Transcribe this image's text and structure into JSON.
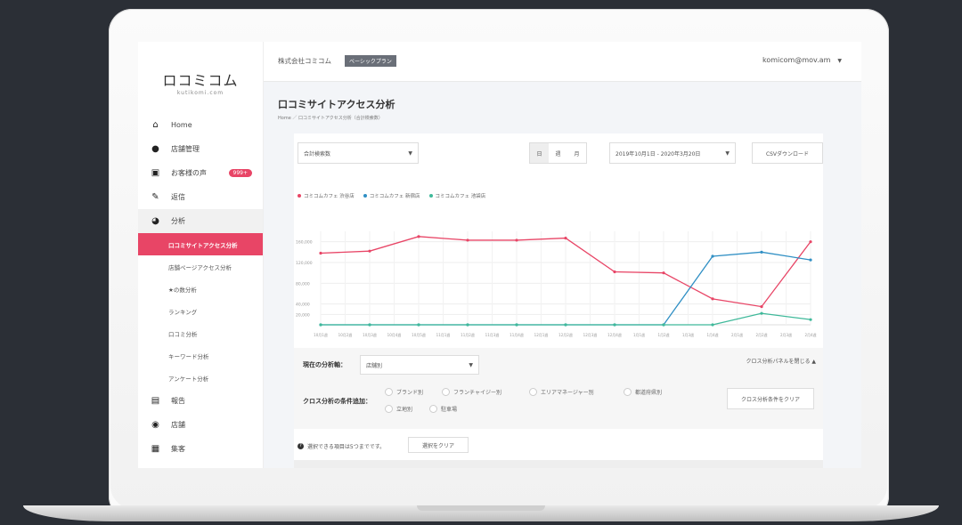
{
  "brand": {
    "logo": "ロコミコム",
    "logo_sub": "kutikomi.com"
  },
  "sidebar": {
    "items": [
      {
        "label": "Home",
        "icon": "home-icon"
      },
      {
        "label": "店舗管理",
        "icon": "store-icon"
      },
      {
        "label": "お客様の声",
        "icon": "voice-icon",
        "badge": "999+"
      },
      {
        "label": "返信",
        "icon": "edit-icon"
      },
      {
        "label": "分析",
        "icon": "pie-icon"
      }
    ],
    "sub_items": [
      {
        "label": "口コミサイトアクセス分析",
        "active": true
      },
      {
        "label": "店舗ページアクセス分析"
      },
      {
        "label": "★の数分析"
      },
      {
        "label": "ランキング"
      },
      {
        "label": "口コミ分析"
      },
      {
        "label": "キーワード分析"
      },
      {
        "label": "アンケート分析"
      }
    ],
    "items_after": [
      {
        "label": "報告",
        "icon": "report-icon"
      },
      {
        "label": "店舗",
        "icon": "location-icon"
      },
      {
        "label": "集客",
        "icon": "grid-icon"
      }
    ]
  },
  "header": {
    "company": "株式会社コミコム",
    "plan": "ベーシックプラン",
    "user": "komicom@mov.am"
  },
  "page": {
    "title": "口コミサイトアクセス分析",
    "breadcrumb": "Home ／ 口コミサイトアクセス分析（合計検索数）"
  },
  "filters": {
    "metric": "合計検索数",
    "periods": [
      "日",
      "週",
      "月"
    ],
    "date_range": "2019年10月1日 - 2020年3月20日",
    "csv_button": "CSVダウンロード"
  },
  "colors": {
    "accent": "#e84566",
    "blue": "#2f8fc4",
    "green": "#3fb99a"
  },
  "chart_data": {
    "type": "line",
    "categories": [
      "10月1週",
      "10月2週",
      "10月3週",
      "10月4週",
      "10月5週",
      "11月1週",
      "11月2週",
      "11月3週",
      "11月4週",
      "12月1週",
      "12月2週",
      "12月3週",
      "12月4週",
      "1月1週",
      "1月2週",
      "1月3週",
      "1月4週",
      "2月1週",
      "2月2週",
      "2月3週",
      "2月4週"
    ],
    "ytick_labels": [
      "160,000",
      "120,000",
      "80,000",
      "40,000",
      "20,000"
    ],
    "ylim": [
      0,
      180000
    ],
    "series": [
      {
        "name": "コミコムカフェ 渋谷店",
        "color": "#e84566",
        "x_index": [
          0,
          2,
          4,
          6,
          8,
          10,
          12,
          14,
          16,
          18,
          20
        ],
        "values": [
          138000,
          142000,
          170000,
          163000,
          163000,
          167000,
          102000,
          100000,
          50000,
          35000,
          160000
        ]
      },
      {
        "name": "コミコムカフェ 新宿店",
        "color": "#2f8fc4",
        "x_index": [
          0,
          2,
          4,
          6,
          8,
          10,
          12,
          14,
          16,
          18,
          20
        ],
        "values": [
          0,
          0,
          0,
          0,
          0,
          0,
          0,
          0,
          132000,
          140000,
          125000
        ]
      },
      {
        "name": "コミコムカフェ 池袋店",
        "color": "#3fb99a",
        "x_index": [
          0,
          2,
          4,
          6,
          8,
          10,
          12,
          14,
          16,
          18,
          20
        ],
        "values": [
          0,
          0,
          0,
          0,
          0,
          0,
          0,
          0,
          0,
          22000,
          10000
        ]
      }
    ]
  },
  "cross": {
    "axis_label": "現在の分析軸：",
    "axis_value": "店舗別",
    "close_panel": "クロス分析パネルを閉じる ▲",
    "condition_label": "クロス分析の条件追加：",
    "options": [
      "ブランド別",
      "フランチャイジー別",
      "エリアマネージャー別",
      "都道府県別",
      "立地別",
      "駐車場"
    ],
    "clear_button": "クロス分析条件をクリア"
  },
  "info": {
    "text": "選択できる項目は5つまでです。",
    "clear_button": "選択をクリア"
  }
}
